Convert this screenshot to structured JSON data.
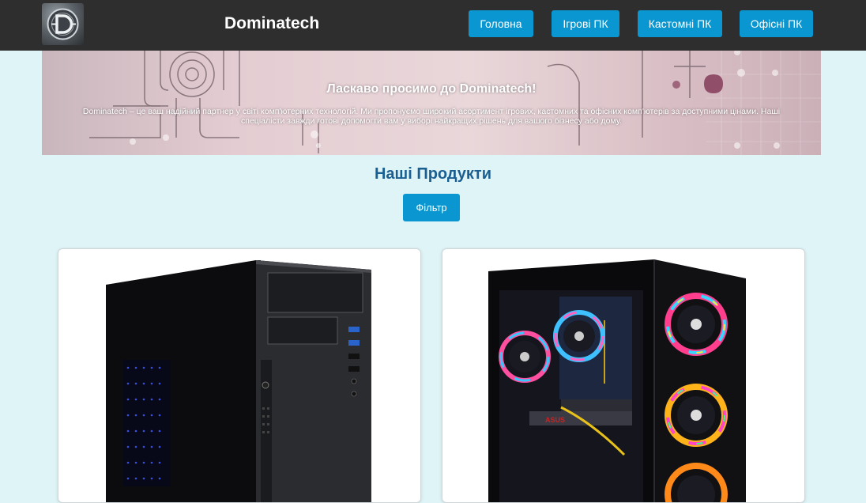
{
  "header": {
    "brand": "Dominatech",
    "nav": [
      {
        "label": "Головна"
      },
      {
        "label": "Ігрові ПК"
      },
      {
        "label": "Кастомні ПК"
      },
      {
        "label": "Офісні ПК"
      }
    ]
  },
  "hero": {
    "title": "Ласкаво просимо до Dominatech!",
    "text": "Dominatech – це ваш надійний партнер у світі комп'ютерних технологій. Ми пропонуємо широкий асортимент ігрових, кастомних та офісних комп'ютерів за доступними цінами. Наші спеціалісти завжди готові допомогти вам у виборі найкращих рішень для вашого бізнесу або дому."
  },
  "products": {
    "title": "Наші Продукти",
    "filter_label": "Фільтр",
    "cards": [
      {
        "image": "black-office-pc-tower"
      },
      {
        "image": "rgb-gaming-pc-tower"
      }
    ]
  },
  "colors": {
    "header_bg": "#2e2e2e",
    "page_bg": "#dff4f7",
    "accent": "#0a96d0",
    "heading": "#1a5f92"
  }
}
